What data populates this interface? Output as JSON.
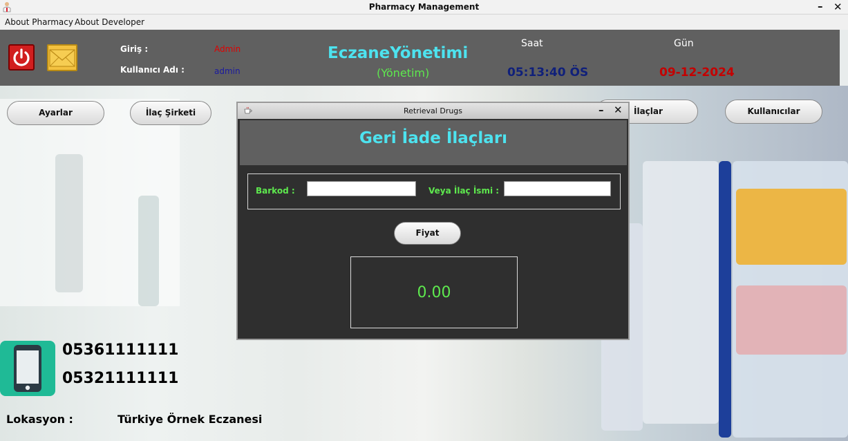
{
  "window": {
    "title": "Pharmacy Management",
    "minimize": "–",
    "close": "✕"
  },
  "menu": {
    "items": [
      "About Pharmacy",
      "About Developer"
    ]
  },
  "header": {
    "login_label": "Giriş :",
    "login_value": "Admin",
    "username_label": "Kullanıcı Adı :",
    "username_value": "admin",
    "brand": "EczaneYönetimi",
    "brand_sub": "(Yönetim)",
    "time_label": "Saat",
    "time_value": "05:13:40 ÖS",
    "day_label": "Gün",
    "day_value": "09-12-2024",
    "colors": {
      "login_value": "#e00000",
      "username_value": "#1a1aa0",
      "time_value": "#10207a",
      "day_value": "#c40000"
    }
  },
  "nav": {
    "settings": "Ayarlar",
    "drug_company": "İlaç Şirketi",
    "drugs": "İlaçlar",
    "users": "Kullanıcılar"
  },
  "contact": {
    "phone_icon": "smartphone-icon",
    "phone1": "05361111111",
    "phone2": "05321111111",
    "location_label": "Lokasyon :",
    "location_value": "Türkiye Örnek Eczanesi"
  },
  "dialog": {
    "title": "Retrieval Drugs",
    "minimize": "–",
    "close": "✕",
    "heading": "Geri İade İlaçları",
    "barcode_label": "Barkod :",
    "barcode_value": "",
    "name_label": "Veya  İlaç İsmi :",
    "name_value": "",
    "price_button": "Fiyat",
    "price_value": "0.00"
  }
}
